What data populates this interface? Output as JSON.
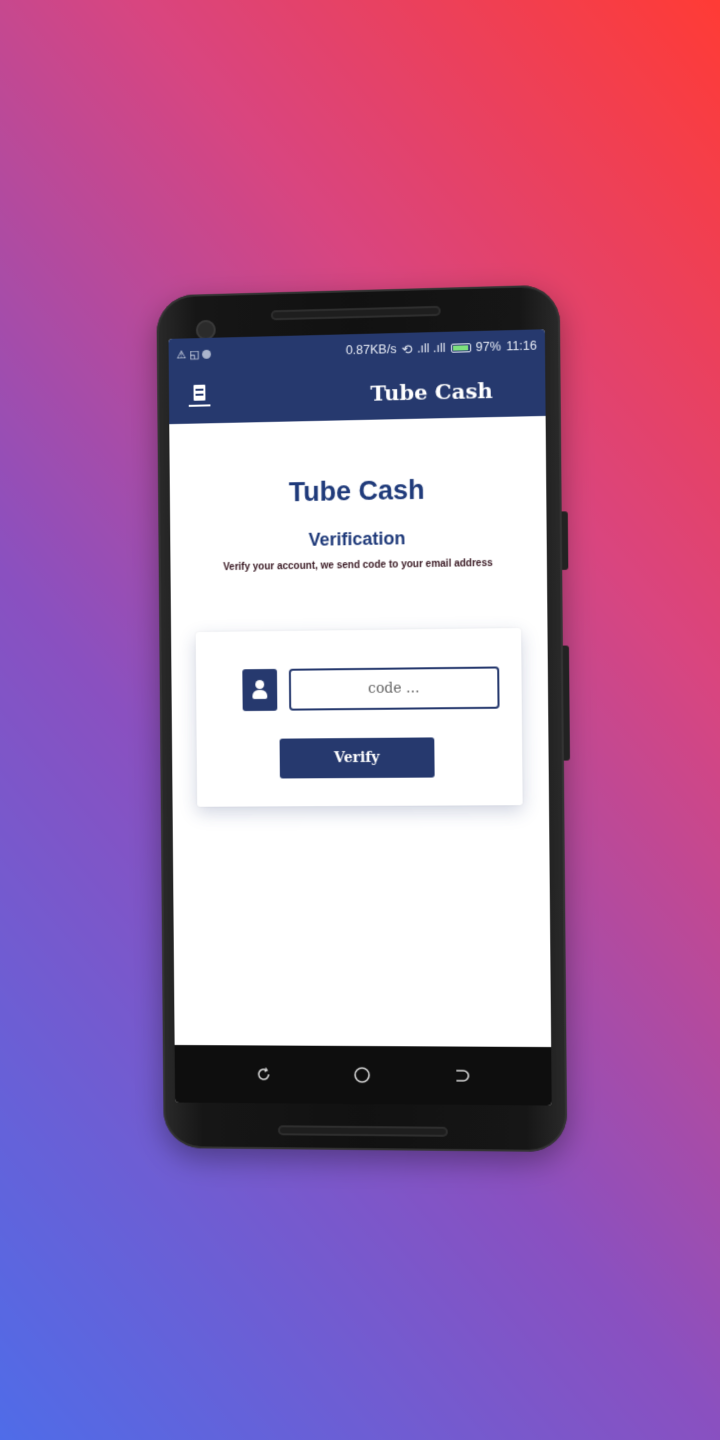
{
  "status_bar": {
    "net_speed": "0.87KB/s",
    "signal": ".ıll .ıll",
    "battery": "97%",
    "time": "11:16"
  },
  "app_bar": {
    "title": "Tube Cash",
    "menu_icon": "server-menu-icon"
  },
  "main": {
    "title": "Tube Cash",
    "subtitle": "Verification",
    "hint": "Verify your account, we send code to your email address"
  },
  "form": {
    "user_icon": "user-icon",
    "code_placeholder": "code ...",
    "code_value": "",
    "verify_label": "Verify"
  },
  "nav_bar": {
    "icons": [
      "recent-apps-icon",
      "home-icon",
      "back-icon"
    ]
  },
  "colors": {
    "primary": "#26396e",
    "title": "#1f3a7a",
    "background_gradient": [
      "#4f6ce8",
      "#8a50c0",
      "#d9457f",
      "#ff3b35"
    ]
  }
}
